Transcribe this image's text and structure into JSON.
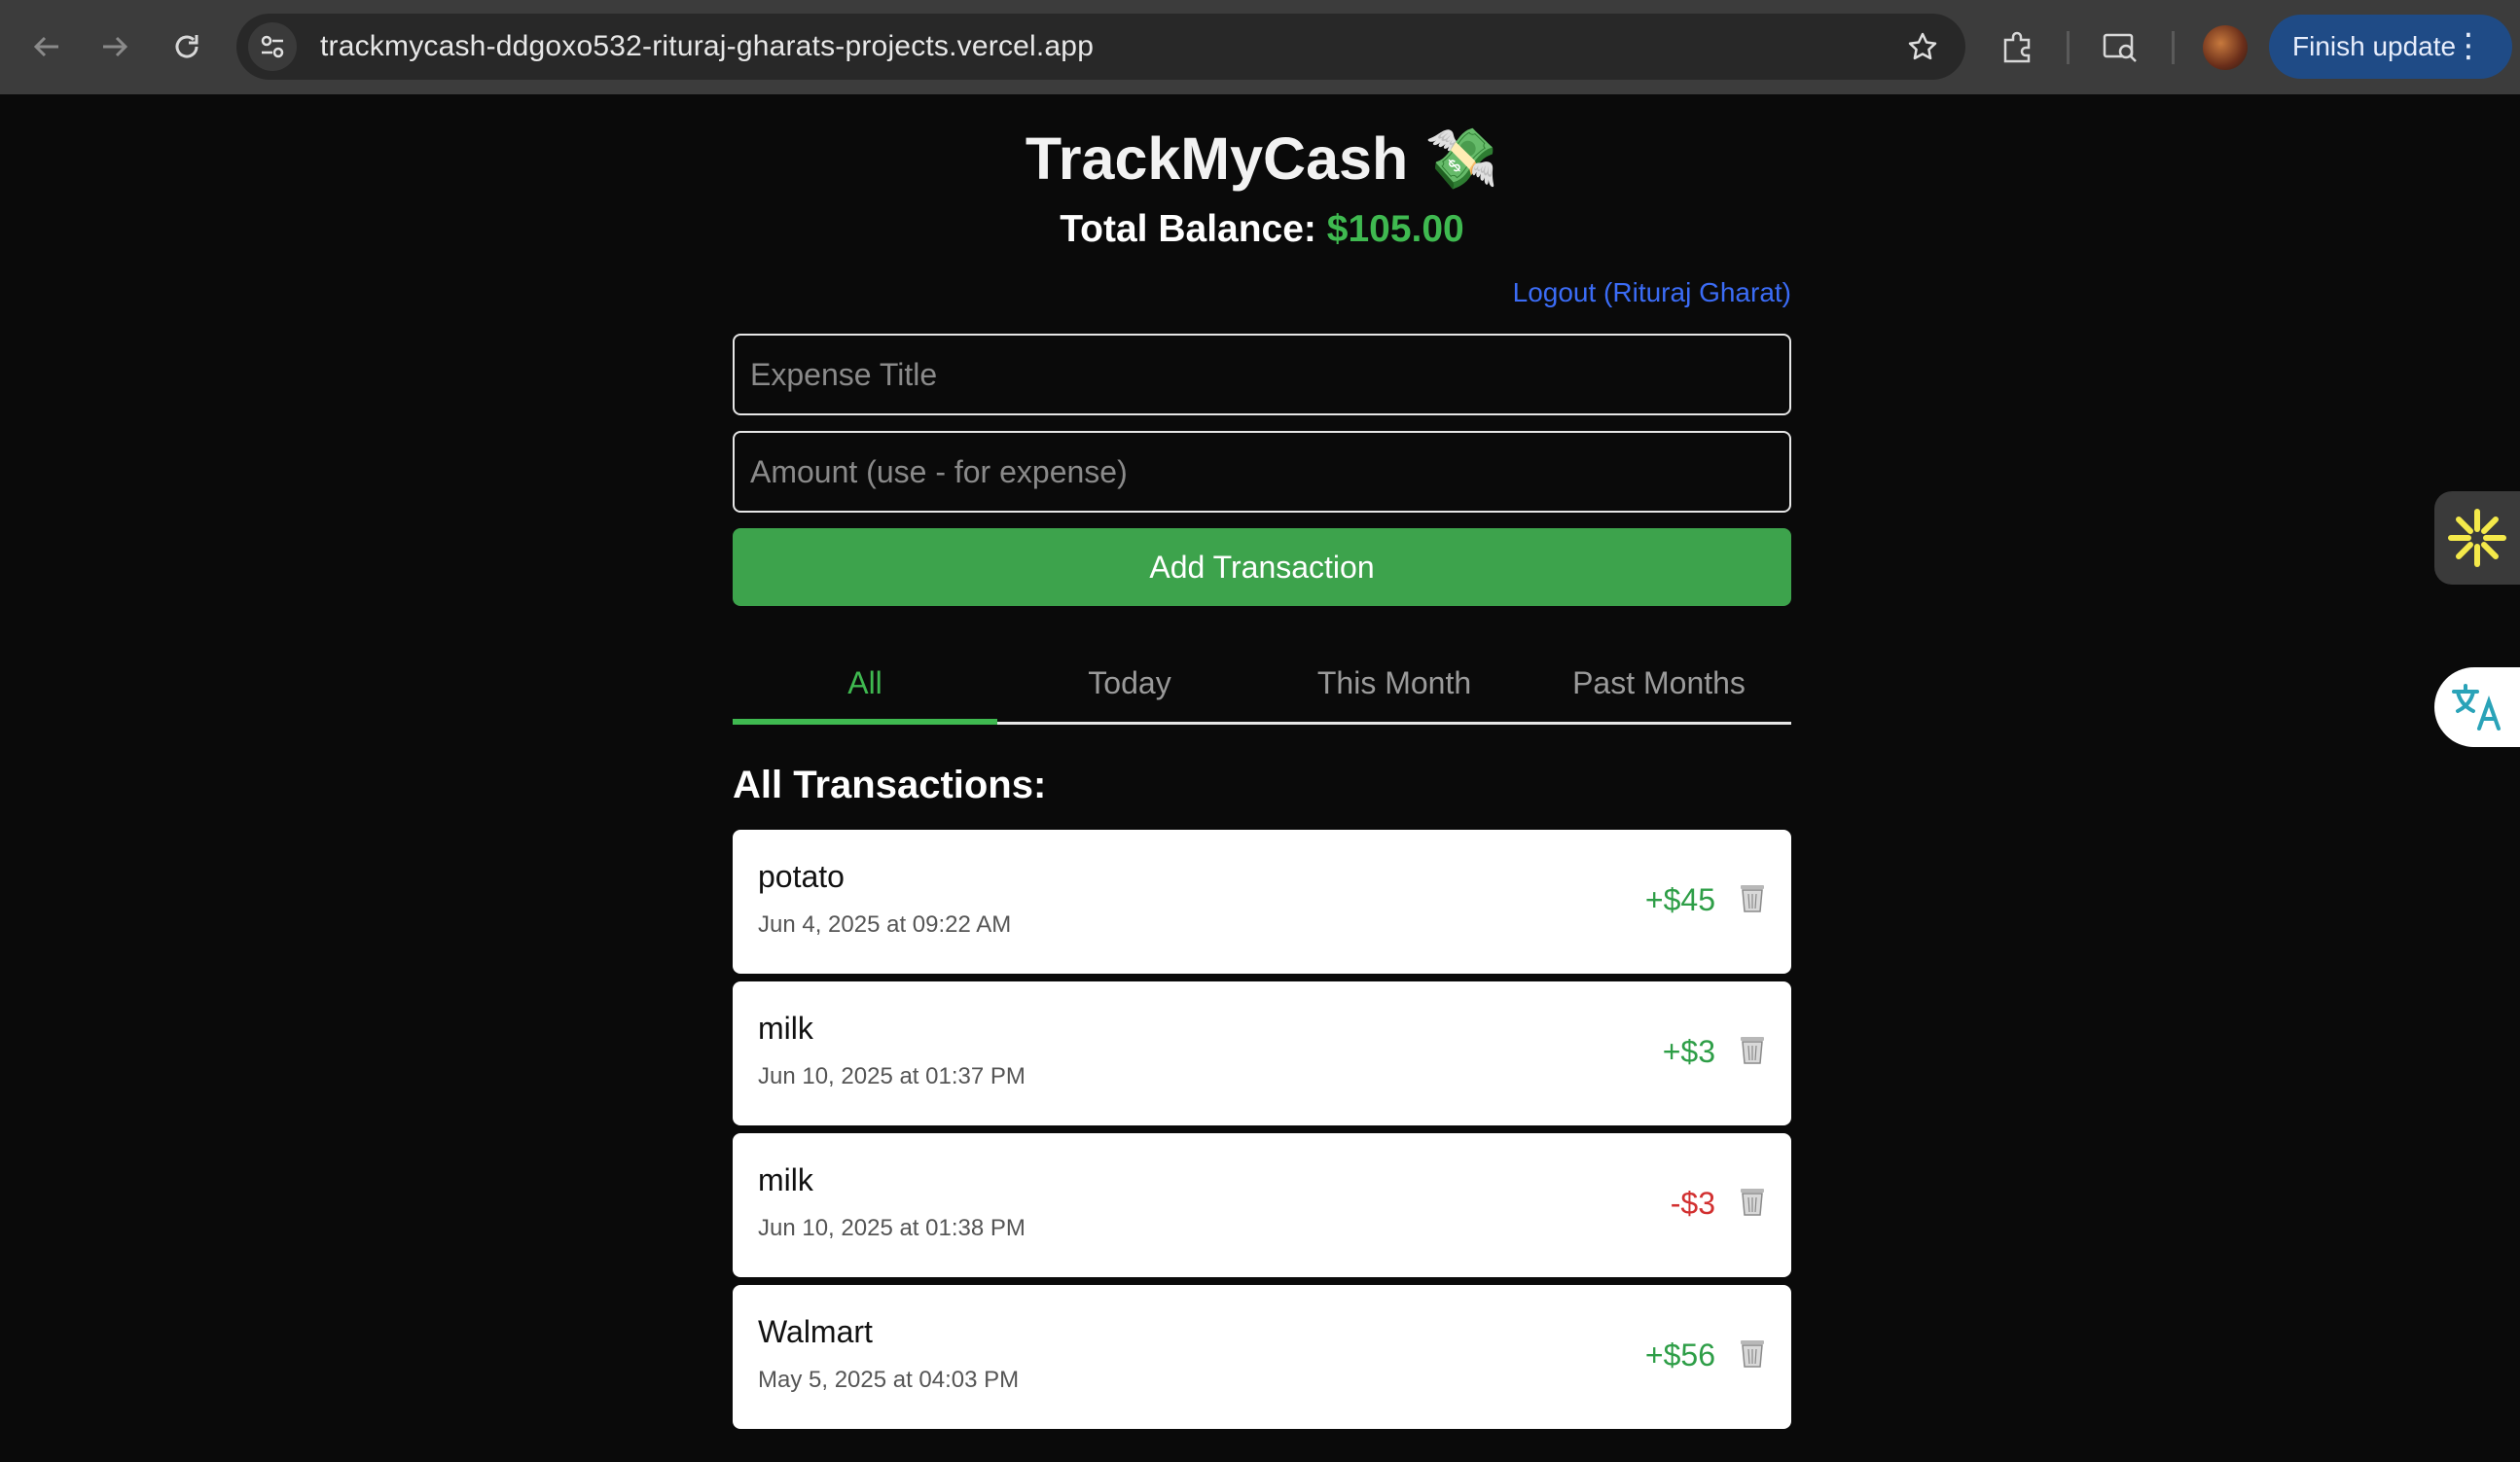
{
  "browser": {
    "url": "trackmycash-ddgoxo532-rituraj-gharats-projects.vercel.app",
    "update_label": "Finish update",
    "icons": [
      "back-arrow-icon",
      "forward-arrow-icon",
      "reload-icon",
      "site-info-icon",
      "star-icon",
      "extensions-icon",
      "media-search-icon",
      "profile-avatar",
      "menu-dots-icon"
    ]
  },
  "app": {
    "title": "TrackMyCash 💸",
    "balance_label": "Total Balance:",
    "balance_value": "$105.00",
    "logout_label": "Logout (Rituraj Gharat)",
    "title_placeholder": "Expense Title",
    "amount_placeholder": "Amount (use - for expense)",
    "add_button": "Add Transaction",
    "tabs": [
      {
        "label": "All",
        "active": true
      },
      {
        "label": "Today",
        "active": false
      },
      {
        "label": "This Month",
        "active": false
      },
      {
        "label": "Past Months",
        "active": false
      }
    ],
    "section_title": "All Transactions:",
    "transactions": [
      {
        "title": "potato",
        "date": "Jun 4, 2025 at 09:22 AM",
        "amount": "+$45",
        "type": "income"
      },
      {
        "title": "milk",
        "date": "Jun 10, 2025 at 01:37 PM",
        "amount": "+$3",
        "type": "income"
      },
      {
        "title": "milk",
        "date": "Jun 10, 2025 at 01:38 PM",
        "amount": "-$3",
        "type": "expense"
      },
      {
        "title": "Walmart",
        "date": "May 5, 2025 at 04:03 PM",
        "amount": "+$56",
        "type": "income"
      }
    ]
  },
  "colors": {
    "accent_green": "#3fb950",
    "button_green": "#3da34c",
    "expense_red": "#d23030",
    "link_blue": "#3b6cf6",
    "background": "#0a0a0a"
  }
}
